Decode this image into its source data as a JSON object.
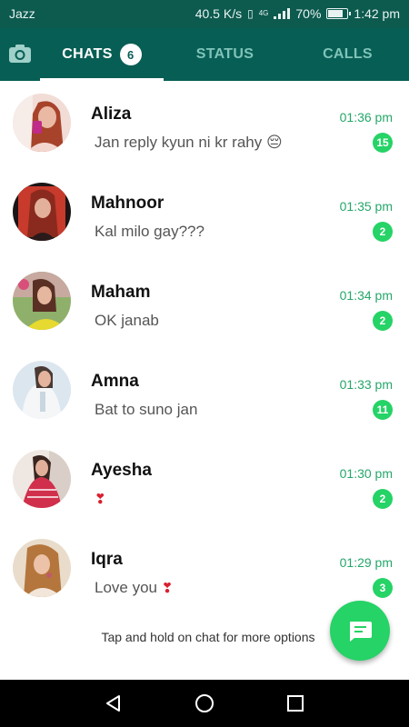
{
  "status_bar": {
    "carrier": "Jazz",
    "speed": "40.5 K/s",
    "network": "4G",
    "battery": "70%",
    "time": "1:42 pm"
  },
  "tabs": {
    "camera_icon": "camera-icon",
    "chats_label": "CHATS",
    "chats_badge": "6",
    "status_label": "STATUS",
    "calls_label": "CALLS"
  },
  "chats": [
    {
      "name": "Aliza",
      "message": "Jan reply kyun ni kr rahy 😔",
      "time": "01:36 pm",
      "unread": "15"
    },
    {
      "name": "Mahnoor",
      "message": "Kal milo gay???",
      "time": "01:35 pm",
      "unread": "2"
    },
    {
      "name": "Maham",
      "message": "OK janab",
      "time": "01:34 pm",
      "unread": "2"
    },
    {
      "name": "Amna",
      "message": "Bat to suno jan",
      "time": "01:33 pm",
      "unread": "11"
    },
    {
      "name": "Ayesha",
      "message": "",
      "time": "01:30 pm",
      "unread": "2",
      "emoji_icon": "heart-exclamation-icon"
    },
    {
      "name": "Iqra",
      "message": "Love you",
      "time": "01:29 pm",
      "unread": "3",
      "emoji_icon": "heart-exclamation-icon"
    }
  ],
  "hint": "Tap and hold on chat for more options",
  "fab_icon": "new-chat-icon",
  "colors": {
    "primary": "#075e54",
    "status_bar": "#0d5a4f",
    "accent": "#25d366",
    "time": "#25a66a"
  }
}
